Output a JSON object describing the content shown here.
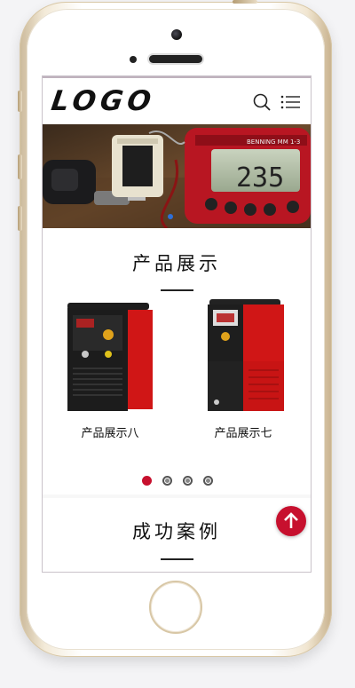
{
  "header": {
    "logo_text": "LOGO",
    "search_icon": "search-icon",
    "menu_icon": "menu-icon"
  },
  "banner": {
    "multimeter_brand": "BENNING MM 1-3",
    "multimeter_reading": "235",
    "slider_dots": 1
  },
  "products": {
    "title": "产品展示",
    "items": [
      {
        "label": "产品展示八"
      },
      {
        "label": "产品展示七"
      }
    ],
    "pagination": {
      "total": 4,
      "active": 1
    }
  },
  "cases": {
    "title": "成功案例"
  },
  "back_to_top_icon": "arrow-up-icon",
  "colors": {
    "accent": "#c7102e",
    "text": "#111111",
    "page_bg": "#f7f7f7"
  }
}
